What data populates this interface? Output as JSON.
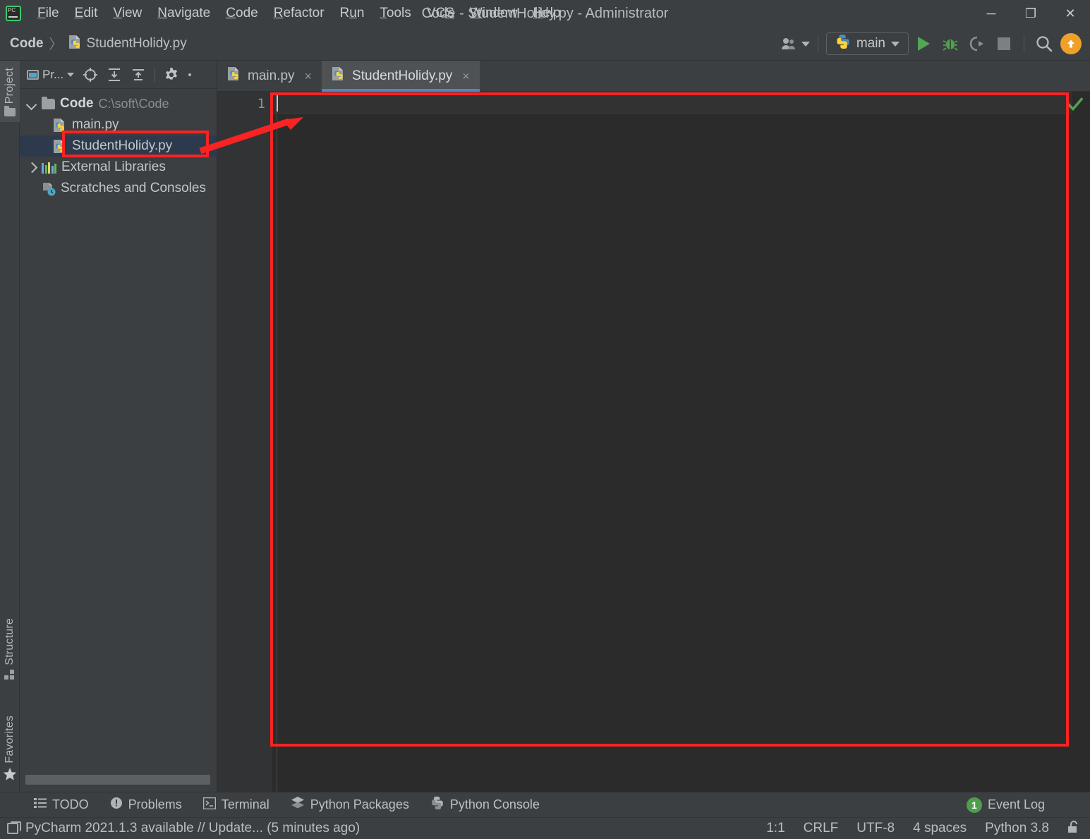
{
  "window": {
    "title": "Code - StudentHolidy.py - Administrator",
    "logo_icon": "pycharm-logo-icon",
    "minimize_icon": "minimize-icon",
    "maximize_icon": "maximize-icon",
    "close_icon": "close-icon",
    "minimize_glyph": "─",
    "maximize_glyph": "❐",
    "close_glyph": "✕"
  },
  "menubar": {
    "items": [
      {
        "label": "File",
        "mnemonic": "F",
        "rest": "ile"
      },
      {
        "label": "Edit",
        "mnemonic": "E",
        "rest": "dit"
      },
      {
        "label": "View",
        "mnemonic": "V",
        "rest": "iew"
      },
      {
        "label": "Navigate",
        "mnemonic": "N",
        "rest": "avigate"
      },
      {
        "label": "Code",
        "mnemonic": "C",
        "rest": "ode"
      },
      {
        "label": "Refactor",
        "mnemonic": "R",
        "rest": "efactor"
      },
      {
        "label": "Run",
        "mnemonic": "u",
        "rest": "n",
        "pre": "R"
      },
      {
        "label": "Tools",
        "mnemonic": "T",
        "rest": "ools"
      },
      {
        "label": "VCS",
        "mnemonic": "S",
        "rest": "",
        "pre": "VC"
      },
      {
        "label": "Window",
        "mnemonic": "W",
        "rest": "indow"
      },
      {
        "label": "Help",
        "mnemonic": "H",
        "rest": "elp"
      }
    ]
  },
  "navbar": {
    "breadcrumb": {
      "project": "Code",
      "separator": "〉",
      "file": "StudentHolidy.py",
      "file_icon": "python-file-icon"
    },
    "toolbar": {
      "user_icon": "user-accounts-icon",
      "run_config_label": "main",
      "run_config_icon": "python-icon",
      "run_icon": "run-icon",
      "debug_icon": "debug-bug-icon",
      "coverage_icon": "run-with-coverage-icon",
      "stop_icon": "stop-icon",
      "search_icon": "search-everywhere-icon",
      "update_icon": "update-project-icon"
    }
  },
  "left_stripe": {
    "tabs": [
      {
        "label": "Project",
        "icon": "folder-icon",
        "active": true
      },
      {
        "label": "Structure",
        "icon": "structure-icon",
        "active": false
      },
      {
        "label": "Favorites",
        "icon": "star-icon",
        "active": false
      }
    ]
  },
  "project_panel": {
    "title": "Pr...",
    "title_icon": "project-window-icon",
    "header_icons": [
      "locate-file-icon",
      "expand-all-icon",
      "collapse-all-icon",
      "settings-gear-icon",
      "more-options-icon"
    ],
    "tree": [
      {
        "label": "Code",
        "path": "C:\\soft\\Code",
        "icon": "folder-icon",
        "twisty": "open",
        "depth": 0,
        "selected": false
      },
      {
        "label": "main.py",
        "path": "",
        "icon": "python-file-icon",
        "twisty": "none",
        "depth": 1,
        "selected": false
      },
      {
        "label": "StudentHolidy.py",
        "path": "",
        "icon": "python-file-icon",
        "twisty": "none",
        "depth": 1,
        "selected": true
      },
      {
        "label": "External Libraries",
        "path": "",
        "icon": "library-icon",
        "twisty": "closed",
        "depth": 0,
        "selected": false
      },
      {
        "label": "Scratches and Consoles",
        "path": "",
        "icon": "scratches-icon",
        "twisty": "none",
        "depth": 0,
        "selected": false
      }
    ]
  },
  "editor": {
    "tabs": [
      {
        "label": "main.py",
        "icon": "python-file-icon",
        "active": false,
        "close": "×"
      },
      {
        "label": "StudentHolidy.py",
        "icon": "python-file-icon",
        "active": true,
        "close": "×"
      }
    ],
    "line_numbers": [
      "1"
    ],
    "content": "",
    "inspection_icon": "inspections-ok-checkmark-icon"
  },
  "annotations": {
    "editor_highlight_color": "#fa2323",
    "tree_highlight_color": "#fa2323",
    "arrow_icon": "red-arrow-pointer"
  },
  "bottom_strip": {
    "items": [
      {
        "label": "TODO",
        "icon": "todo-list-icon"
      },
      {
        "label": "Problems",
        "icon": "problems-warning-icon"
      },
      {
        "label": "Terminal",
        "icon": "terminal-icon"
      },
      {
        "label": "Python Packages",
        "icon": "python-packages-icon"
      },
      {
        "label": "Python Console",
        "icon": "python-console-icon"
      }
    ],
    "event_log": {
      "label": "Event Log",
      "count": "1",
      "icon": "event-log-badge"
    }
  },
  "statusbar": {
    "message": "PyCharm 2021.1.3 available // Update... (5 minutes ago)",
    "message_icon": "ide-update-icon",
    "caret_position": "1:1",
    "line_separator": "CRLF",
    "encoding": "UTF-8",
    "indent": "4 spaces",
    "interpreter": "Python 3.8",
    "lock_icon": "unlocked-readonly-icon"
  },
  "colors": {
    "panel_bg": "#3c3f41",
    "editor_bg": "#2b2b2b",
    "gutter_bg": "#313335",
    "selection_bg": "#2d3a4d",
    "tab_active_bg": "#4e5254",
    "tab_underline": "#4a88c7",
    "accent_green": "#53a653",
    "accent_orange": "#efa02a",
    "annotation_red": "#fa2323"
  }
}
